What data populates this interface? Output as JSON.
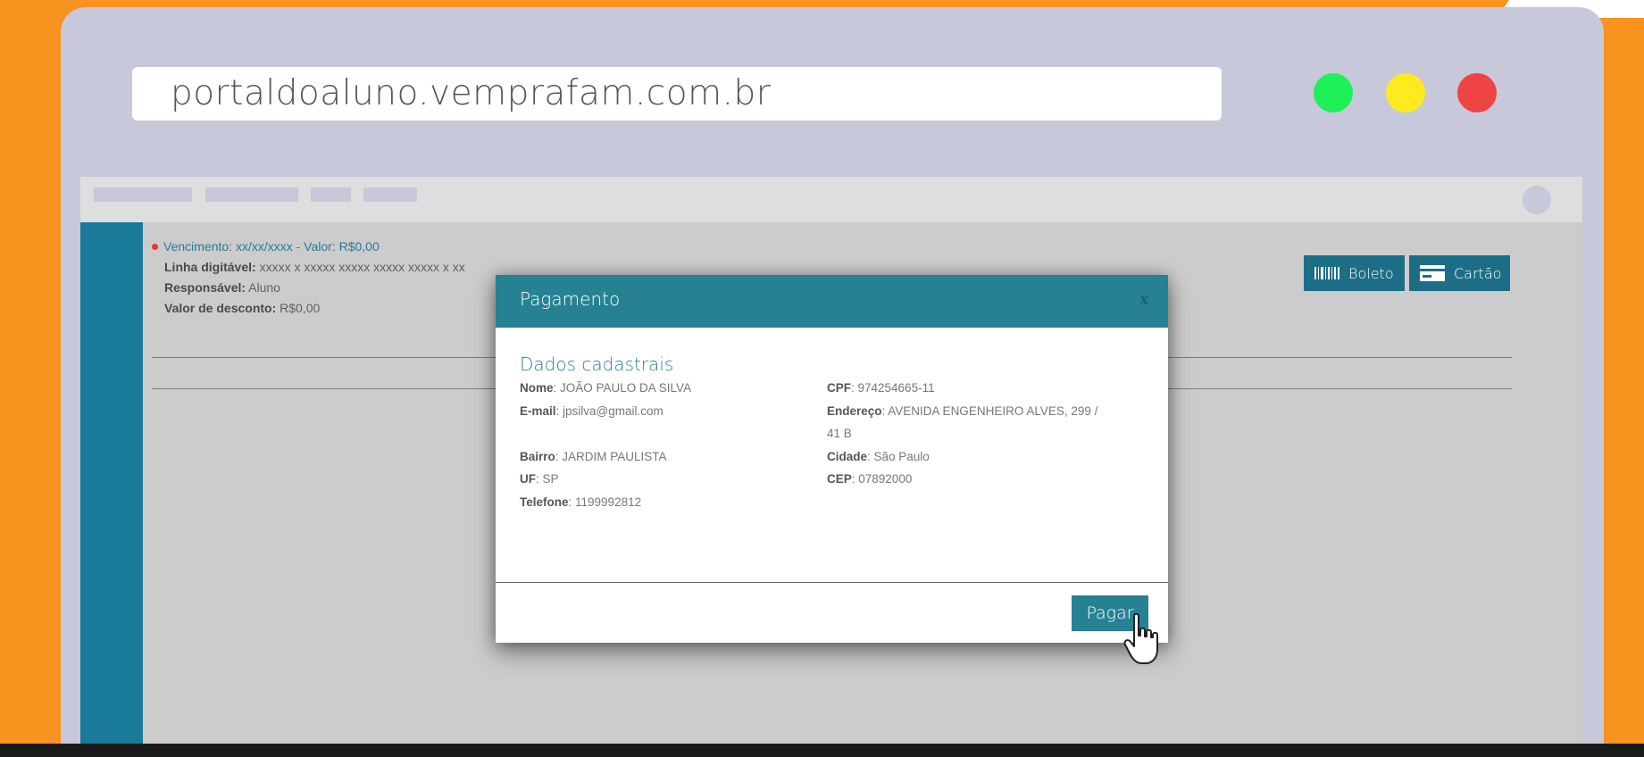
{
  "browser": {
    "url": "portaldoaluno.vemprafam.com.br",
    "window_dots": [
      {
        "name": "green",
        "color": "#1EF157"
      },
      {
        "name": "yellow",
        "color": "#FFEA1F"
      },
      {
        "name": "red",
        "color": "#EF4444"
      }
    ]
  },
  "colors": {
    "background": "#F7931E",
    "browser_frame": "#C7C8DA",
    "sidebar": "#1A7A99",
    "accent": "#268292",
    "status_dot": "#E53935"
  },
  "invoice": {
    "vencimento": "Vencimento: xx/xx/xxxx - Valor: R$0,00",
    "linha_label": "Linha digitável:",
    "linha_value": " xxxxx x xxxxx xxxxx xxxxx xxxxx x xx",
    "responsavel_label": "Responsável:",
    "responsavel_value": " Aluno",
    "desconto_label": "Valor de desconto:",
    "desconto_value": " R$0,00",
    "buttons": {
      "boleto": "Boleto",
      "cartao": "Cartão"
    },
    "icons": {
      "boleto": "barcode-icon",
      "cartao": "credit-card-icon"
    }
  },
  "modal": {
    "title": "Pagamento",
    "close": "x",
    "section_title": "Dados cadastrais",
    "fields": {
      "nome": {
        "label": "Nome",
        "value": ": JOÃO PAULO DA SILVA"
      },
      "email": {
        "label": "E-mail",
        "value": ": jpsilva@gmail.com"
      },
      "bairro": {
        "label": "Bairro",
        "value": ": JARDIM PAULISTA"
      },
      "uf": {
        "label": "UF",
        "value": ": SP"
      },
      "telefone": {
        "label": "Telefone",
        "value": ": 1199992812"
      },
      "cpf": {
        "label": "CPF",
        "value": ": 974254665-11"
      },
      "endereco": {
        "label": "Endereço",
        "value": ": AVENIDA ENGENHEIRO ALVES, 299 /",
        "value_cont": "41 B"
      },
      "cidade": {
        "label": "Cidade",
        "value": ": São Paulo"
      },
      "cep": {
        "label": "CEP",
        "value": ": 07892000"
      }
    },
    "submit": "Pagar"
  },
  "cursor": "hand-pointer-icon"
}
